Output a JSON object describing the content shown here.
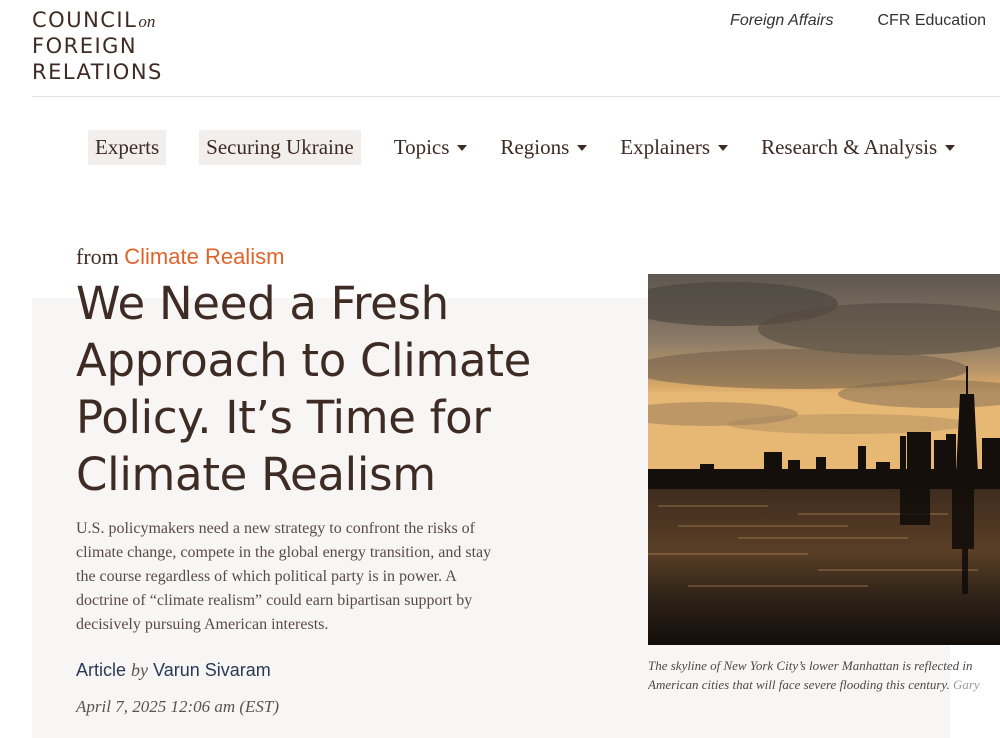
{
  "logo": {
    "line1": "COUNCIL",
    "on": "on",
    "line2": "FOREIGN",
    "line3": "RELATIONS"
  },
  "top_links": [
    "Foreign Affairs",
    "CFR Education"
  ],
  "nav": {
    "experts": "Experts",
    "securing_ukraine": "Securing Ukraine",
    "topics": "Topics",
    "regions": "Regions",
    "explainers": "Explainers",
    "research": "Research & Analysis"
  },
  "article": {
    "from_prefix": "from",
    "series": "Climate Realism",
    "headline": "We Need a Fresh Approach to Climate Policy. It’s Time for Climate Realism",
    "summary": "U.S. policymakers need a new strategy to confront the risks of climate change, compete in the global energy transition, and stay the course regardless of which political party is in power. A doctrine of “climate realism” could earn bipartisan support by decisively pursuing American interests.",
    "type": "Article",
    "by": "by",
    "author": "Varun Sivaram",
    "date": "April 7, 2025 12:06 am (EST)"
  },
  "image": {
    "caption_line1": "The skyline of New York City’s lower Manhattan is reflected in",
    "caption_line2": "American cities that will face severe flooding this century.",
    "caption_credit": "Gary"
  },
  "colors": {
    "accent": "#e0632b",
    "text": "#3d2b24",
    "panel": "#f7f6f5",
    "nav_box": "#f1eeeb"
  }
}
